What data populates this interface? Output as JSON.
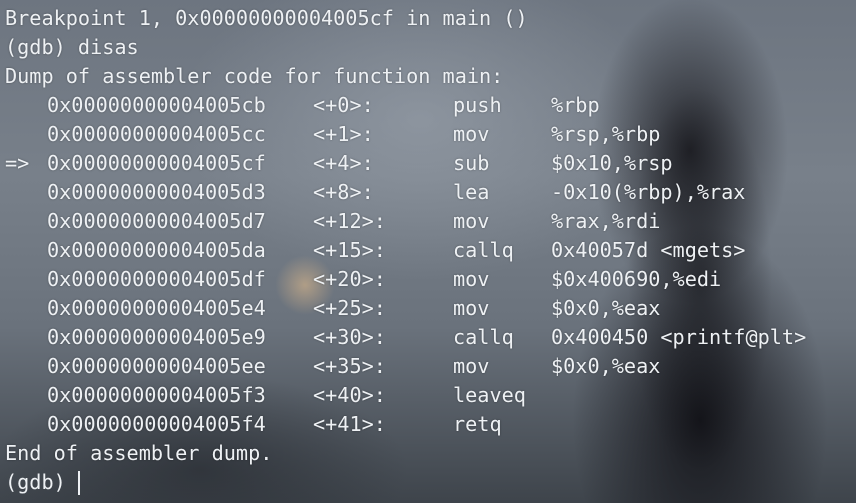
{
  "terminal": {
    "breakpoint_line": "Breakpoint 1, 0x00000000004005cf in main ()",
    "command_line": "(gdb) disas",
    "dump_header": "Dump of assembler code for function main:",
    "current_marker": "=>",
    "instructions": [
      {
        "address": "0x00000000004005cb",
        "offset": "<+0>:",
        "mnemonic": "push",
        "operands": "%rbp",
        "current": false
      },
      {
        "address": "0x00000000004005cc",
        "offset": "<+1>:",
        "mnemonic": "mov",
        "operands": "%rsp,%rbp",
        "current": false
      },
      {
        "address": "0x00000000004005cf",
        "offset": "<+4>:",
        "mnemonic": "sub",
        "operands": "$0x10,%rsp",
        "current": true
      },
      {
        "address": "0x00000000004005d3",
        "offset": "<+8>:",
        "mnemonic": "lea",
        "operands": "-0x10(%rbp),%rax",
        "current": false
      },
      {
        "address": "0x00000000004005d7",
        "offset": "<+12>:",
        "mnemonic": "mov",
        "operands": "%rax,%rdi",
        "current": false
      },
      {
        "address": "0x00000000004005da",
        "offset": "<+15>:",
        "mnemonic": "callq",
        "operands": "0x40057d <mgets>",
        "current": false
      },
      {
        "address": "0x00000000004005df",
        "offset": "<+20>:",
        "mnemonic": "mov",
        "operands": "$0x400690,%edi",
        "current": false
      },
      {
        "address": "0x00000000004005e4",
        "offset": "<+25>:",
        "mnemonic": "mov",
        "operands": "$0x0,%eax",
        "current": false
      },
      {
        "address": "0x00000000004005e9",
        "offset": "<+30>:",
        "mnemonic": "callq",
        "operands": "0x400450 <printf@plt>",
        "current": false
      },
      {
        "address": "0x00000000004005ee",
        "offset": "<+35>:",
        "mnemonic": "mov",
        "operands": "$0x0,%eax",
        "current": false
      },
      {
        "address": "0x00000000004005f3",
        "offset": "<+40>:",
        "mnemonic": "leaveq",
        "operands": "",
        "current": false
      },
      {
        "address": "0x00000000004005f4",
        "offset": "<+41>:",
        "mnemonic": "retq",
        "operands": "",
        "current": false
      }
    ],
    "dump_footer": "End of assembler dump.",
    "prompt": "(gdb)",
    "text_color": "#eef1f4"
  }
}
